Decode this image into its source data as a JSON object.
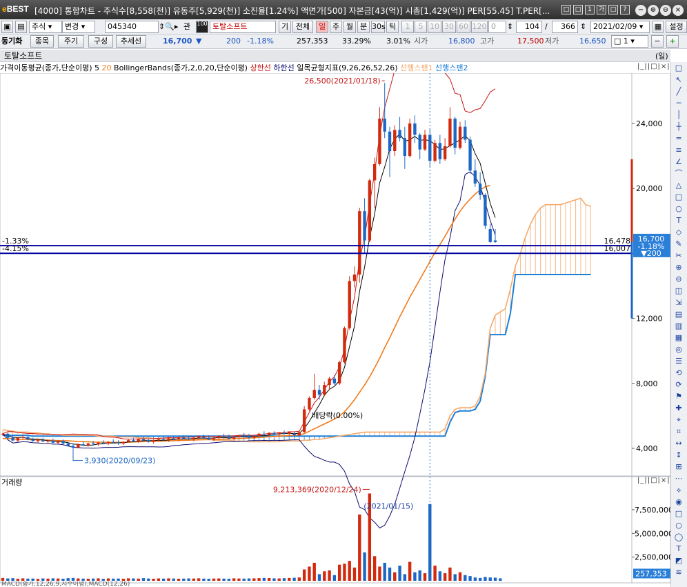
{
  "window": {
    "logo_e": "e",
    "logo_rest": "BEST",
    "title": "[4000] 통합차트 - 주식수[8,558(천)] 유동주[5,929(천)] 소진율[1.24%] 액면가[500] 자본금[43(억)] 시총[1,429(억)] PER[55.45] T.PER[...",
    "small_buttons": [
      "□",
      "□",
      "1",
      "가",
      "□",
      "?"
    ],
    "window_buttons": [
      "−",
      "⊕",
      "⊖",
      "×"
    ]
  },
  "toolbar1": {
    "market": "주식",
    "change_label": "변경",
    "code": "045340",
    "related_label": "관",
    "hundred_label": "100",
    "stock_name": "토탈소프트",
    "gi_label": "기",
    "all_label": "전체",
    "periods": [
      "일",
      "주",
      "월",
      "분",
      "30s",
      "틱"
    ],
    "minute_values": [
      "1",
      "5",
      "10",
      "30",
      "60",
      "120"
    ],
    "count_a": "0",
    "bars_shown": "104",
    "slash": "/",
    "bars_total": "366",
    "date": "2021/02/09",
    "settings_label": "설정"
  },
  "toolbar2": {
    "sync_label": "동기화",
    "item_label": "종목",
    "period_label": "주기",
    "config_label": "구성",
    "trend_label": "추세선",
    "price": "16,700",
    "price_arrow": "▼",
    "change": "200",
    "change_pct": "-1.18%",
    "volume": "257,353",
    "ratio1": "33.29%",
    "ratio2": "3.01%",
    "open_label": "시가",
    "open": "16,800",
    "high_label": "고가",
    "high": "17,500",
    "low_label": "저가",
    "low": "16,650",
    "spin_value": "1"
  },
  "chart_header": {
    "stock_name": "토탈소프트",
    "unit": "(일)"
  },
  "legend": {
    "ma": "가격이동평균(종가,단순이평)",
    "ma5": "5",
    "ma20": "20",
    "bb": "BollingerBands(종가,2,0,20,단순이평)",
    "bb_upper": "상한선",
    "bb_lower": "하한선",
    "ichimoku": "일목균형지표(9,26,26,52,26)",
    "span1": "선행스팬1",
    "span2": "선행스팬2"
  },
  "volume_panel": {
    "title": "거래량",
    "bottom_label": "MACD(종가,12,26,9,지수이평),MACD(12,26)"
  },
  "annotations": {
    "high_label": "26,500(2021/01/18)",
    "low_label": "3,930(2020/09/23)",
    "ex_label": "배당락(0.00%)",
    "line1_pct": "-1.33%",
    "line2_pct": "-4.15%",
    "line1_value": "16,478",
    "line2_value": "16,007",
    "vol_high_label": "9,213,369(2020/12/24)",
    "vol_cursor_label": "(2021/01/15)",
    "price_tag_price": "16,700",
    "price_tag_pct": "-1.18%",
    "price_tag_change": "▼200",
    "vol_tag": "257,353"
  },
  "colors": {
    "up": "#d22a0e",
    "down": "#1d67c4",
    "ma5": "#000000",
    "ma20": "#f07a1a",
    "bb": "#c81414",
    "bb_lower": "#0a0a6e",
    "span1": "#f5a96b",
    "span2": "#1b7fd8",
    "hline": "#0000a0"
  },
  "chart_data": [
    {
      "type": "candlestick",
      "title": "토탈소프트",
      "y_ticks": [
        4000,
        8000,
        12000,
        16000,
        20000,
        24000
      ],
      "y_tick_labels": [
        "4,000",
        "8,000",
        "12,000",
        "16,000",
        "20,000",
        "24,000"
      ],
      "ylim": [
        2300,
        27100
      ],
      "candles": [
        [
          4850,
          4950,
          4780,
          4900
        ],
        [
          4900,
          4950,
          4550,
          4650
        ],
        [
          4650,
          4800,
          4450,
          4480
        ],
        [
          4480,
          4700,
          4400,
          4650
        ],
        [
          4650,
          4800,
          4550,
          4700
        ],
        [
          4700,
          4750,
          4500,
          4550
        ],
        [
          4550,
          4650,
          4400,
          4450
        ],
        [
          4450,
          4600,
          4350,
          4500
        ],
        [
          4500,
          4650,
          4380,
          4420
        ],
        [
          4420,
          4550,
          4300,
          4480
        ],
        [
          4480,
          4600,
          4300,
          4350
        ],
        [
          4350,
          4500,
          4250,
          4450
        ],
        [
          4450,
          4550,
          4250,
          4300
        ],
        [
          4300,
          4400,
          4100,
          4150
        ],
        [
          4150,
          4300,
          3930,
          4050
        ],
        [
          4050,
          4300,
          4000,
          4250
        ],
        [
          4250,
          4400,
          4150,
          4180
        ],
        [
          4180,
          4350,
          4100,
          4300
        ],
        [
          4300,
          4450,
          4200,
          4250
        ],
        [
          4250,
          4400,
          4150,
          4350
        ],
        [
          4350,
          4500,
          4250,
          4300
        ],
        [
          4300,
          4450,
          4200,
          4400
        ],
        [
          4400,
          4550,
          4300,
          4350
        ],
        [
          4350,
          4500,
          4200,
          4300
        ],
        [
          4300,
          4450,
          4200,
          4400
        ],
        [
          4400,
          4550,
          4350,
          4500
        ],
        [
          4500,
          4650,
          4400,
          4450
        ],
        [
          4450,
          4600,
          4350,
          4550
        ],
        [
          4550,
          4700,
          4400,
          4500
        ],
        [
          4500,
          4600,
          4350,
          4400
        ],
        [
          4400,
          4550,
          4300,
          4500
        ],
        [
          4500,
          4650,
          4400,
          4550
        ],
        [
          4550,
          4700,
          4450,
          4500
        ],
        [
          4500,
          4650,
          4400,
          4600
        ],
        [
          4600,
          4750,
          4500,
          4550
        ],
        [
          4550,
          4700,
          4450,
          4650
        ],
        [
          4650,
          4800,
          4550,
          4600
        ],
        [
          4600,
          4750,
          4500,
          4550
        ],
        [
          4550,
          4700,
          4450,
          4650
        ],
        [
          4650,
          4800,
          4550,
          4700
        ],
        [
          4700,
          4850,
          4600,
          4650
        ],
        [
          4650,
          4800,
          4500,
          4550
        ],
        [
          4550,
          4700,
          4450,
          4650
        ],
        [
          4650,
          4800,
          4550,
          4750
        ],
        [
          4750,
          4900,
          4650,
          4700
        ],
        [
          4700,
          4850,
          4550,
          4600
        ],
        [
          4600,
          4750,
          4500,
          4700
        ],
        [
          4700,
          4850,
          4600,
          4800
        ],
        [
          4800,
          4950,
          4700,
          4750
        ],
        [
          4750,
          4900,
          4600,
          4650
        ],
        [
          4650,
          4800,
          4550,
          4750
        ],
        [
          4750,
          4950,
          4700,
          4900
        ],
        [
          4900,
          5050,
          4800,
          4850
        ],
        [
          4850,
          5000,
          4750,
          4950
        ],
        [
          4950,
          5050,
          4800,
          4850
        ],
        [
          4850,
          5000,
          4750,
          4950
        ],
        [
          4950,
          5100,
          4850,
          4900
        ],
        [
          4900,
          5050,
          4800,
          5000
        ],
        [
          4900,
          5000,
          4700,
          4800
        ],
        [
          4800,
          5100,
          4750,
          5000
        ],
        [
          5000,
          6600,
          4950,
          6400
        ],
        [
          6400,
          7200,
          6300,
          7100
        ],
        [
          7100,
          8600,
          7000,
          7600
        ],
        [
          7600,
          7900,
          7000,
          7300
        ],
        [
          7300,
          8100,
          7200,
          7900
        ],
        [
          7900,
          8400,
          7600,
          8300
        ],
        [
          8300,
          8500,
          7900,
          8000
        ],
        [
          8000,
          9400,
          7900,
          9300
        ],
        [
          9300,
          11500,
          9200,
          11400
        ],
        [
          11400,
          14600,
          11300,
          14300
        ],
        [
          14300,
          15200,
          13900,
          14700
        ],
        [
          14700,
          18800,
          14200,
          18600
        ],
        [
          18600,
          19400,
          16000,
          16800
        ],
        [
          16800,
          20600,
          16700,
          20500
        ],
        [
          20500,
          21900,
          18800,
          21500
        ],
        [
          21500,
          25000,
          21400,
          24300
        ],
        [
          24300,
          26500,
          23100,
          23500
        ],
        [
          23500,
          23800,
          20700,
          22300
        ],
        [
          22300,
          23900,
          22000,
          23600
        ],
        [
          23600,
          24400,
          22900,
          23100
        ],
        [
          23100,
          23800,
          21200,
          22000
        ],
        [
          22000,
          24300,
          21900,
          24000
        ],
        [
          24000,
          24500,
          22800,
          23300
        ],
        [
          23300,
          23400,
          21800,
          22400
        ],
        [
          22400,
          23600,
          22300,
          23300
        ],
        [
          23300,
          23700,
          21300,
          21700
        ],
        [
          21700,
          23000,
          21600,
          22800
        ],
        [
          22800,
          23300,
          21500,
          21800
        ],
        [
          21800,
          23100,
          21700,
          22600
        ],
        [
          22600,
          25000,
          22500,
          24300
        ],
        [
          24300,
          24400,
          22100,
          22500
        ],
        [
          22500,
          24100,
          22400,
          23800
        ],
        [
          23800,
          24200,
          22800,
          23000
        ],
        [
          23000,
          23200,
          20900,
          21100
        ],
        [
          21100,
          21800,
          20100,
          20300
        ],
        [
          20300,
          21000,
          19300,
          19600
        ],
        [
          19600,
          19700,
          17500,
          17700
        ],
        [
          17500,
          17800,
          16650,
          16700
        ],
        [
          16800,
          17500,
          16650,
          16700
        ]
      ],
      "ma20": [
        4600,
        4600,
        4580,
        4560,
        4550,
        4540,
        4530,
        4520,
        4510,
        4500,
        4490,
        4480,
        4470,
        4460,
        4440,
        4420,
        4410,
        4400,
        4390,
        4380,
        4380,
        4370,
        4370,
        4370,
        4370,
        4380,
        4390,
        4400,
        4410,
        4420,
        4430,
        4440,
        4450,
        4460,
        4470,
        4480,
        4490,
        4500,
        4510,
        4520,
        4530,
        4540,
        4550,
        4560,
        4570,
        4580,
        4590,
        4600,
        4620,
        4640,
        4650,
        4670,
        4690,
        4710,
        4730,
        4750,
        4770,
        4790,
        4800,
        4820,
        4900,
        5050,
        5200,
        5350,
        5500,
        5650,
        5800,
        6000,
        6250,
        6600,
        7000,
        7450,
        7900,
        8400,
        8950,
        9550,
        10200,
        10800,
        11450,
        12100,
        12700,
        13300,
        13850,
        14400,
        14950,
        15500,
        16050,
        16550,
        17050,
        17600,
        18100,
        18600,
        19000,
        19350,
        19650,
        19900,
        20100,
        20200
      ],
      "span1": [
        5150,
        5100,
        5050,
        5000,
        5000,
        5000,
        4950,
        4950,
        4900,
        4900,
        4850,
        4850,
        4800,
        4800,
        4800,
        4800,
        4800,
        4800,
        4800,
        4750,
        4750,
        4750,
        4750,
        4700,
        4700,
        4700,
        4700,
        4650,
        4650,
        4650,
        4600,
        4600,
        4600,
        4600,
        4600,
        4550,
        4550,
        4550,
        4550,
        4550,
        4550,
        4550,
        4500,
        4500,
        4500,
        4500,
        4450,
        4450,
        4450,
        4400,
        4400,
        4400,
        4400,
        4400,
        4400,
        4400,
        4450,
        4450,
        4450,
        4450,
        4500,
        4500,
        4550,
        4550,
        4600,
        4650,
        4700,
        4750,
        4800,
        4850,
        4900,
        4950,
        5000,
        5000,
        5000,
        5000,
        5000,
        5000,
        5000,
        5000,
        5000,
        5000,
        5000,
        5000,
        5000,
        5000,
        5000,
        5000,
        5200,
        6000,
        6400,
        6500,
        6500,
        6500,
        6600,
        7200,
        8600,
        11400,
        12200,
        12400,
        12600,
        13800,
        15200,
        16000,
        17000,
        17800,
        18400,
        18800,
        19000,
        19000,
        19000,
        19000,
        19100,
        19200,
        19300,
        19400,
        19000,
        18900
      ],
      "span2": [
        4800,
        4800,
        4800,
        4800,
        4800,
        4800,
        4750,
        4750,
        4750,
        4750,
        4750,
        4750,
        4750,
        4750,
        4750,
        4750,
        4750,
        4750,
        4750,
        4750,
        4750,
        4750,
        4750,
        4750,
        4750,
        4750,
        4750,
        4750,
        4750,
        4750,
        4750,
        4750,
        4750,
        4750,
        4750,
        4750,
        4750,
        4750,
        4750,
        4750,
        4750,
        4750,
        4750,
        4750,
        4750,
        4750,
        4750,
        4750,
        4750,
        4750,
        4750,
        4750,
        4750,
        4750,
        4750,
        4750,
        4750,
        4750,
        4750,
        4750,
        4750,
        4750,
        4750,
        4750,
        4750,
        4750,
        4750,
        4750,
        4750,
        4750,
        4750,
        4750,
        4750,
        4750,
        4750,
        4750,
        4750,
        4750,
        4750,
        4750,
        4750,
        4750,
        4750,
        4750,
        4750,
        4750,
        4750,
        4750,
        4750,
        5600,
        6200,
        6300,
        6300,
        6300,
        6400,
        6900,
        8400,
        11000,
        11000,
        11000,
        11000,
        12300,
        14700,
        14700,
        14700,
        14700,
        14700,
        14700,
        14700,
        14700,
        14700,
        14700,
        14700,
        14700,
        14700,
        14700,
        14700,
        14700
      ]
    },
    {
      "type": "bar",
      "title": "거래량",
      "y_ticks": [
        2500000,
        5000000,
        7500000
      ],
      "y_tick_labels": [
        "2,500,000",
        "5,000,000",
        "7,500,000"
      ],
      "ylim": [
        0,
        9900000
      ],
      "values": [
        300000,
        250000,
        280000,
        220000,
        260000,
        230000,
        240000,
        210000,
        250000,
        230000,
        260000,
        240000,
        220000,
        280000,
        300000,
        250000,
        230000,
        220000,
        240000,
        260000,
        210000,
        250000,
        230000,
        240000,
        220000,
        260000,
        250000,
        230000,
        280000,
        240000,
        220000,
        250000,
        230000,
        260000,
        240000,
        220000,
        230000,
        250000,
        240000,
        260000,
        230000,
        220000,
        240000,
        250000,
        230000,
        220000,
        260000,
        240000,
        230000,
        250000,
        260000,
        280000,
        300000,
        290000,
        260000,
        250000,
        280000,
        300000,
        320000,
        350000,
        1200000,
        1500000,
        1900000,
        700000,
        1000000,
        1100000,
        600000,
        1700000,
        1800000,
        2100000,
        1400000,
        7000000,
        3000000,
        9213369,
        2600000,
        1500000,
        1900000,
        1400000,
        900000,
        1600000,
        700000,
        2000000,
        900000,
        1100000,
        800000,
        8100000,
        1600000,
        1000000,
        800000,
        1400000,
        700000,
        900000,
        600000,
        500000,
        350000,
        300000,
        400000,
        350000,
        330000,
        257353
      ]
    }
  ],
  "right_tools": [
    "□",
    "↖",
    "╱",
    "─",
    "│",
    "┼",
    "═",
    "≡",
    "∠",
    "⌒",
    "△",
    "□",
    "○",
    "T",
    "◇",
    "✎",
    "✂",
    "⊕",
    "⊖",
    "◫",
    "⇲",
    "▤",
    "▥",
    "▦",
    "◎",
    "☰",
    "⟲",
    "⟳",
    "⚑",
    "✚",
    "⌖",
    "⌗",
    "↔",
    "↕",
    "⊞",
    "⋯",
    "⟡",
    "◉",
    "□",
    "○",
    "◯",
    "T",
    "◩",
    "≋"
  ]
}
